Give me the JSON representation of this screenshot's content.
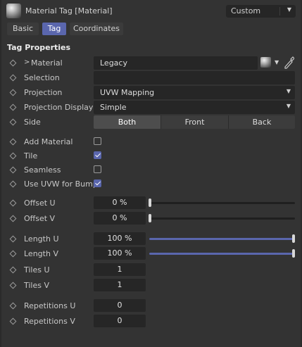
{
  "header": {
    "title": "Material Tag [Material]",
    "mode_value": "Custom",
    "material_icon": "material-sphere-icon"
  },
  "tabs": [
    {
      "label": "Basic",
      "active": false
    },
    {
      "label": "Tag",
      "active": true
    },
    {
      "label": "Coordinates",
      "active": false
    }
  ],
  "section": {
    "title": "Tag Properties"
  },
  "fields": {
    "material": {
      "label": "Material",
      "value": "Legacy"
    },
    "selection": {
      "label": "Selection",
      "value": ""
    },
    "projection": {
      "label": "Projection",
      "value": "UVW Mapping"
    },
    "projection_display": {
      "label": "Projection Display",
      "value": "Simple"
    },
    "side": {
      "label": "Side",
      "options": [
        "Both",
        "Front",
        "Back"
      ],
      "selected": "Both"
    }
  },
  "checkboxes": [
    {
      "label": "Add Material",
      "checked": false
    },
    {
      "label": "Tile",
      "checked": true
    },
    {
      "label": "Seamless",
      "checked": false
    },
    {
      "label": "Use UVW for Bump",
      "checked": true
    }
  ],
  "offsets": [
    {
      "label": "Offset U",
      "value": "0 %",
      "level": 0
    },
    {
      "label": "Offset V",
      "value": "0 %",
      "level": 0
    }
  ],
  "lengths": [
    {
      "label": "Length U",
      "value": "100 %",
      "level": 1
    },
    {
      "label": "Length V",
      "value": "100 %",
      "level": 1
    }
  ],
  "tiles": [
    {
      "label": "Tiles U",
      "value": "1"
    },
    {
      "label": "Tiles V",
      "value": "1"
    }
  ],
  "repetitions": [
    {
      "label": "Repetitions U",
      "value": "0"
    },
    {
      "label": "Repetitions V",
      "value": "0"
    }
  ],
  "colors": {
    "accent": "#5a66ad",
    "background": "#333333",
    "field": "#262626"
  }
}
